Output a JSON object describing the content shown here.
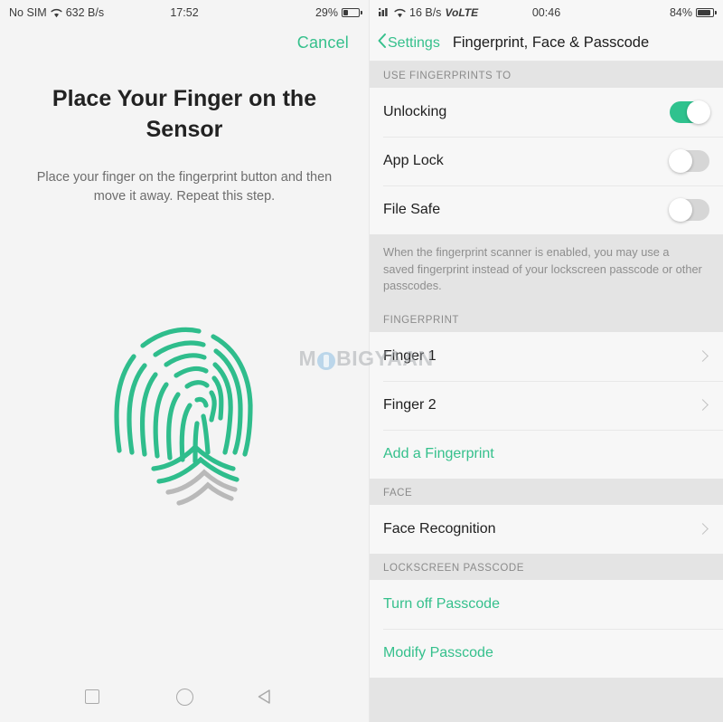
{
  "left_phone": {
    "status_bar": {
      "carrier": "No SIM",
      "wifi_icon": "wifi-icon",
      "network_speed": "632 B/s",
      "clock": "17:52",
      "battery_percent": "29%",
      "battery_level": 29
    },
    "cancel_label": "Cancel",
    "title": "Place Your Finger on the Sensor",
    "subtitle": "Place your finger on the fingerprint button and then move it away. Repeat this step.",
    "fingerprint_graphic": {
      "icon": "fingerprint-icon",
      "scanned_color": "#2fbd8c",
      "unscanned_color": "#b9b9b9"
    },
    "nav_bar": {
      "recents": "square-recents-icon",
      "home": "circle-home-icon",
      "back": "triangle-back-icon"
    }
  },
  "right_phone": {
    "status_bar": {
      "signal_icon": "signal-bars-icon",
      "wifi_icon": "wifi-icon",
      "network_speed": "16 B/s",
      "network_type": "VoLTE",
      "clock": "00:46",
      "battery_percent": "84%",
      "battery_level": 84
    },
    "header": {
      "back_label": "Settings",
      "title": "Fingerprint, Face & Passcode"
    },
    "sections": [
      {
        "label": "USE FINGERPRINTS TO",
        "rows": [
          {
            "label": "Unlocking",
            "control": "toggle",
            "value": "on"
          },
          {
            "label": "App Lock",
            "control": "toggle",
            "value": "off"
          },
          {
            "label": "File Safe",
            "control": "toggle",
            "value": "off"
          }
        ]
      }
    ],
    "note": "When the fingerprint scanner is enabled, you may use a saved fingerprint instead of your lockscreen passcode or other passcodes.",
    "fingerprint_section": {
      "label": "FINGERPRINT",
      "rows": [
        {
          "label": "Finger 1",
          "control": "chevron"
        },
        {
          "label": "Finger 2",
          "control": "chevron"
        },
        {
          "label": "Add a Fingerprint",
          "control": "none",
          "style": "green"
        }
      ]
    },
    "face_section": {
      "label": "FACE",
      "rows": [
        {
          "label": "Face Recognition",
          "control": "chevron"
        }
      ]
    },
    "passcode_section": {
      "label": "LOCKSCREEN PASSCODE",
      "rows": [
        {
          "label": "Turn off Passcode",
          "control": "none",
          "style": "green"
        },
        {
          "label": "Modify Passcode",
          "control": "none",
          "style": "green"
        }
      ]
    }
  },
  "watermark": {
    "text_before": "M",
    "text_after": "BIGYAAN"
  },
  "colors": {
    "accent_green": "#35c08c",
    "toggle_on": "#2fc28e",
    "toggle_off": "#d6d6d6",
    "page_bg": "#e4e4e4",
    "card_bg": "#f7f7f7"
  }
}
